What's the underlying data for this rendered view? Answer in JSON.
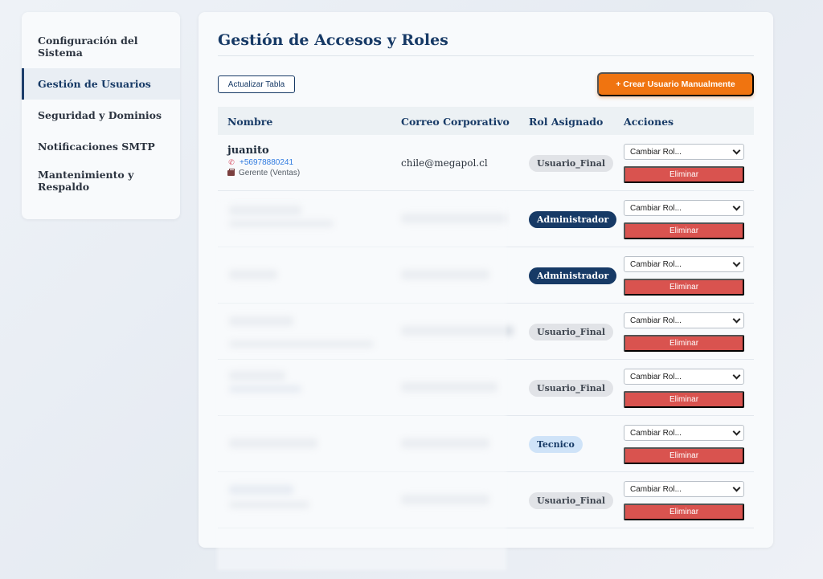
{
  "sidebar": {
    "items": [
      {
        "label": "Configuración del Sistema",
        "active": false
      },
      {
        "label": "Gestión de Usuarios",
        "active": true
      },
      {
        "label": "Seguridad y Dominios",
        "active": false
      },
      {
        "label": "Notificaciones SMTP",
        "active": false
      },
      {
        "label": "Mantenimiento y Respaldo",
        "active": false
      }
    ]
  },
  "main": {
    "title": "Gestión de Accesos y Roles",
    "refresh_label": "Actualizar Tabla",
    "create_label": "+ Crear Usuario Manualmente",
    "columns": [
      "Nombre",
      "Correo Corporativo",
      "Rol Asignado",
      "Acciones"
    ],
    "select_placeholder": "Cambiar Rol...",
    "delete_label": "Eliminar",
    "rows": [
      {
        "name": "juanito",
        "phone": "+56978880241",
        "job": "Gerente (Ventas)",
        "email": "chile@megapol.cl",
        "role": "Usuario_Final",
        "blurred": false
      },
      {
        "name": "",
        "phone": "",
        "job": "",
        "email": "",
        "role": "Administrador",
        "blurred": true
      },
      {
        "name": "",
        "phone": "",
        "job": "",
        "email": "",
        "role": "Administrador",
        "blurred": true
      },
      {
        "name": "",
        "phone": "",
        "job": "",
        "email": "",
        "role": "Usuario_Final",
        "blurred": true
      },
      {
        "name": "",
        "phone": "",
        "job": "",
        "email": "",
        "role": "Usuario_Final",
        "blurred": true
      },
      {
        "name": "",
        "phone": "",
        "job": "",
        "email": "",
        "role": "Tecnico",
        "blurred": true
      },
      {
        "name": "",
        "phone": "",
        "job": "",
        "email": "",
        "role": "Usuario_Final",
        "blurred": true
      }
    ]
  },
  "colors": {
    "primary": "#173a66",
    "accent_orange": "#f07410",
    "danger": "#d9534f",
    "phone_blue": "#2f7be0"
  },
  "icons": {
    "phone": "phone-icon",
    "job": "briefcase-icon",
    "select": "chevron-down-icon"
  }
}
